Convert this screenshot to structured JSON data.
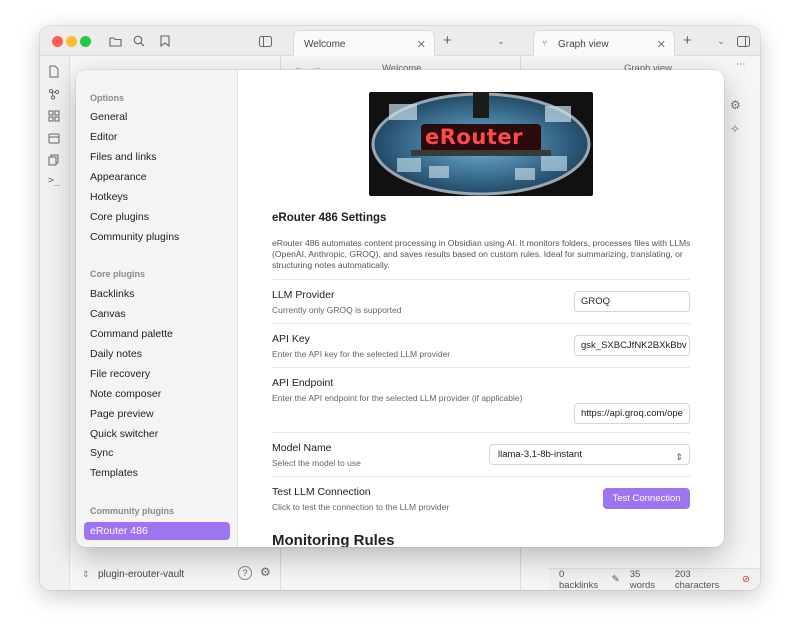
{
  "window": {
    "tabs": [
      {
        "label": "Welcome"
      },
      {
        "label": "Graph view"
      }
    ],
    "pane_titles": [
      "Welcome",
      "Graph view"
    ],
    "vault_name": "plugin-erouter-vault",
    "status": {
      "backlinks": "0 backlinks",
      "words": "35 words",
      "characters": "203 characters"
    }
  },
  "sidebar": {
    "options_heading": "Options",
    "options": [
      "General",
      "Editor",
      "Files and links",
      "Appearance",
      "Hotkeys",
      "Core plugins",
      "Community plugins"
    ],
    "core_heading": "Core plugins",
    "core": [
      "Backlinks",
      "Canvas",
      "Command palette",
      "Daily notes",
      "File recovery",
      "Note composer",
      "Page preview",
      "Quick switcher",
      "Sync",
      "Templates"
    ],
    "community_heading": "Community plugins",
    "community": [
      "eRouter 486"
    ]
  },
  "main": {
    "hero_text": "eRouter",
    "title": "eRouter 486 Settings",
    "description": "eRouter 486 automates content processing in Obsidian using AI. It monitors folders, processes files with LLMs (OpenAI, Anthropic, GROQ), and saves results based on custom rules. Ideal for summarizing, translating, or structuring notes automatically.",
    "settings": [
      {
        "name": "LLM Provider",
        "desc": "Currently only GROQ is supported",
        "value": "GROQ"
      },
      {
        "name": "API Key",
        "desc": "Enter the API key for the selected LLM provider",
        "value": "gsk_SXBCJfNK2BXkBbv"
      },
      {
        "name": "API Endpoint",
        "desc": "Enter the API endpoint for the selected LLM provider (if applicable)",
        "value": "https://api.groq.com/ope"
      },
      {
        "name": "Model Name",
        "desc": "Select the model to use",
        "value": "llama-3.1-8b-instant"
      },
      {
        "name": "Test LLM Connection",
        "desc": "Click to test the connection to the LLM provider",
        "button": "Test Connection"
      }
    ],
    "section_title": "Monitoring Rules"
  },
  "colors": {
    "accent": "#9d75f0"
  }
}
